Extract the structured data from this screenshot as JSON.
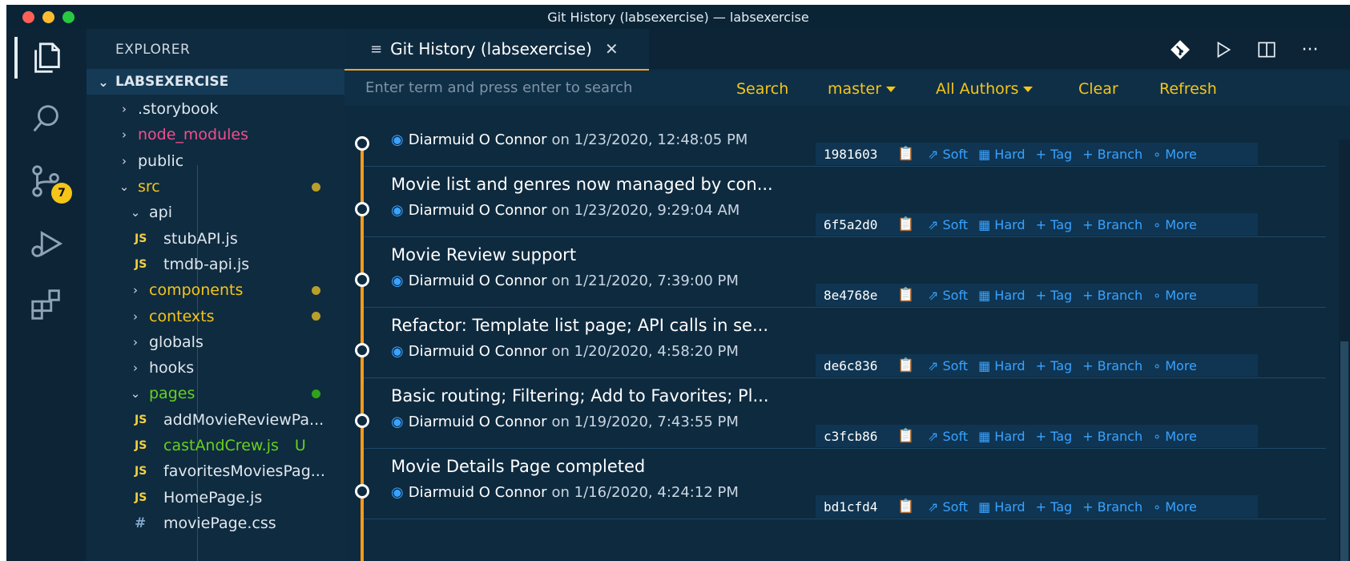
{
  "window": {
    "title": "Git History (labsexercise) — labsexercise"
  },
  "activity": {
    "scm_badge": "7"
  },
  "sidebar": {
    "title": "EXPLORER",
    "section": "LABSEXERCISE",
    "items": [
      {
        "label": ".storybook",
        "type": "folder",
        "state": "collapsed",
        "indent": 36,
        "color": "#dfe7ee"
      },
      {
        "label": "node_modules",
        "type": "folder",
        "state": "collapsed",
        "indent": 36,
        "color": "#f14e8c"
      },
      {
        "label": "public",
        "type": "folder",
        "state": "collapsed",
        "indent": 36,
        "color": "#dfe7ee"
      },
      {
        "label": "src",
        "type": "folder",
        "state": "expanded",
        "indent": 36,
        "color": "#f5c518",
        "dot": "#b99f2a"
      },
      {
        "label": "api",
        "type": "folder",
        "state": "expanded",
        "indent": 50,
        "color": "#dfe7ee"
      },
      {
        "label": "stubAPI.js",
        "type": "js",
        "indent": 60,
        "color": "#dfe7ee"
      },
      {
        "label": "tmdb-api.js",
        "type": "js",
        "indent": 60,
        "color": "#dfe7ee"
      },
      {
        "label": "components",
        "type": "folder",
        "state": "collapsed",
        "indent": 50,
        "color": "#f5c518",
        "dot": "#b99f2a"
      },
      {
        "label": "contexts",
        "type": "folder",
        "state": "collapsed",
        "indent": 50,
        "color": "#f5c518",
        "dot": "#b99f2a"
      },
      {
        "label": "globals",
        "type": "folder",
        "state": "collapsed",
        "indent": 50,
        "color": "#dfe7ee"
      },
      {
        "label": "hooks",
        "type": "folder",
        "state": "collapsed",
        "indent": 50,
        "color": "#dfe7ee"
      },
      {
        "label": "pages",
        "type": "folder",
        "state": "expanded",
        "indent": 50,
        "color": "#66d21a",
        "dot": "#2fa31a"
      },
      {
        "label": "addMovieReviewPa...",
        "type": "js",
        "indent": 60,
        "color": "#dfe7ee"
      },
      {
        "label": "castAndCrew.js",
        "type": "js",
        "indent": 60,
        "color": "#66d21a",
        "flag": "U"
      },
      {
        "label": "favoritesMoviesPag...",
        "type": "js",
        "indent": 60,
        "color": "#dfe7ee"
      },
      {
        "label": "HomePage.js",
        "type": "js",
        "indent": 60,
        "color": "#dfe7ee"
      },
      {
        "label": "moviePage.css",
        "type": "css",
        "indent": 60,
        "color": "#dfe7ee"
      }
    ]
  },
  "editor": {
    "tab_title": "Git History (labsexercise)",
    "search": {
      "placeholder": "Enter term and press enter to search"
    },
    "toolbar": {
      "search": "Search",
      "branch": "master",
      "authors": "All Authors",
      "clear": "Clear",
      "refresh": "Refresh"
    },
    "actions": {
      "soft": "Soft",
      "hard": "Hard",
      "tag": "Tag",
      "branch": "Branch",
      "more": "More"
    },
    "commits": [
      {
        "message": "",
        "author": "Diarmuid O Connor",
        "date": "on 1/23/2020, 12:48:05 PM",
        "hash": "1981603"
      },
      {
        "message": "Movie list and genres now managed by con...",
        "author": "Diarmuid O Connor",
        "date": "on 1/23/2020, 9:29:04 AM",
        "hash": "6f5a2d0"
      },
      {
        "message": "Movie Review support",
        "author": "Diarmuid O Connor",
        "date": "on 1/21/2020, 7:39:00 PM",
        "hash": "8e4768e"
      },
      {
        "message": "Refactor: Template list page; API calls in se...",
        "author": "Diarmuid O Connor",
        "date": "on 1/20/2020, 4:58:20 PM",
        "hash": "de6c836"
      },
      {
        "message": "Basic routing; Filtering; Add to Favorites; Pl...",
        "author": "Diarmuid O Connor",
        "date": "on 1/19/2020, 7:43:55 PM",
        "hash": "c3fcb86"
      },
      {
        "message": "Movie Details Page completed",
        "author": "Diarmuid O Connor",
        "date": "on 1/16/2020, 4:24:12 PM",
        "hash": "bd1cfd4"
      }
    ]
  }
}
